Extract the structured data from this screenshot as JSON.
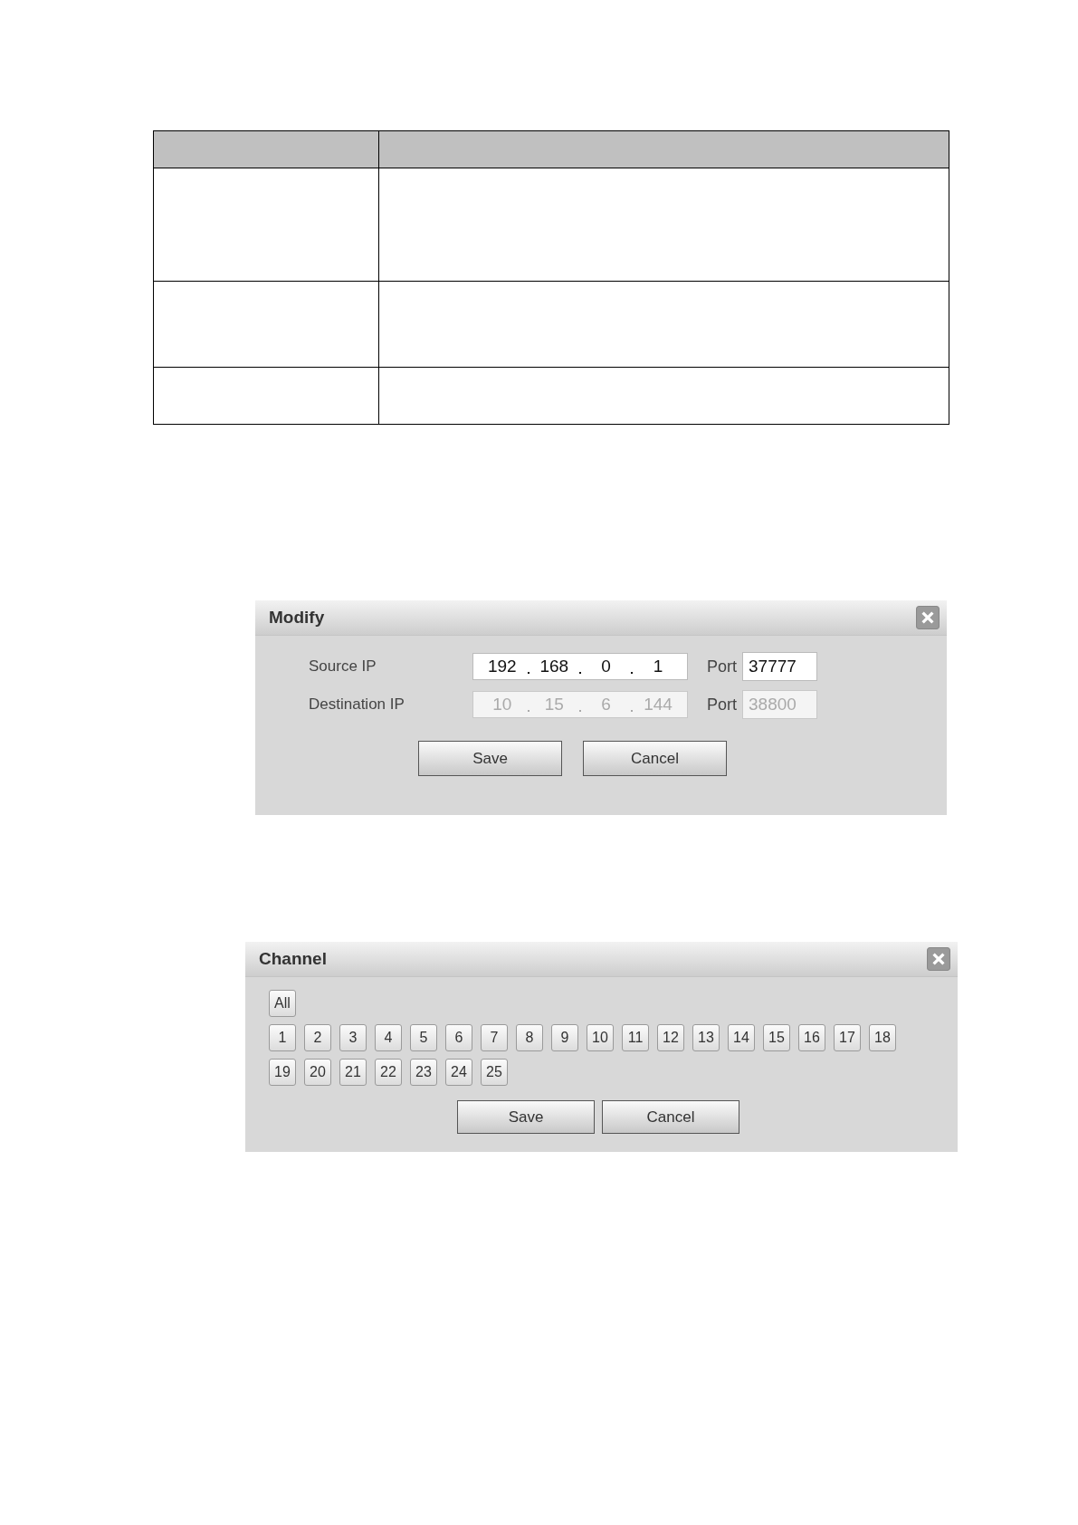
{
  "modify_dialog": {
    "title": "Modify",
    "rows": [
      {
        "label": "Source IP",
        "octets": [
          "192",
          "168",
          "0",
          "1"
        ],
        "port_label": "Port",
        "port": "37777",
        "disabled": false
      },
      {
        "label": "Destination IP",
        "octets": [
          "10",
          "15",
          "6",
          "144"
        ],
        "port_label": "Port",
        "port": "38800",
        "disabled": true
      }
    ],
    "buttons": [
      "Save",
      "Cancel"
    ]
  },
  "channel_dialog": {
    "title": "Channel",
    "all_label": "All",
    "channels": [
      "1",
      "2",
      "3",
      "4",
      "5",
      "6",
      "7",
      "8",
      "9",
      "10",
      "11",
      "12",
      "13",
      "14",
      "15",
      "16",
      "17",
      "18",
      "19",
      "20",
      "21",
      "22",
      "23",
      "24",
      "25"
    ],
    "buttons": [
      "Save",
      "Cancel"
    ]
  }
}
